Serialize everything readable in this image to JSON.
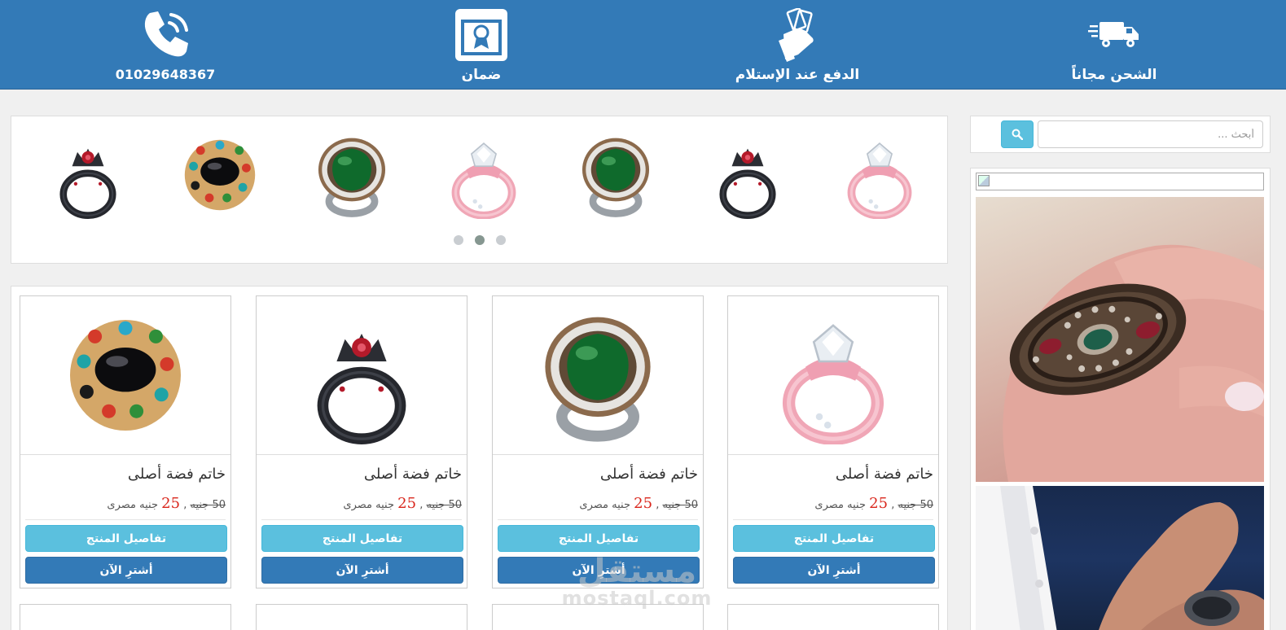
{
  "topbar": {
    "features": [
      {
        "icon": "truck-icon",
        "label": "الشحن مجاناً"
      },
      {
        "icon": "hand-money-icon",
        "label": "الدفع عند الإستلام"
      },
      {
        "icon": "certificate-icon",
        "label": "ضمان"
      },
      {
        "icon": "phone-icon",
        "label": "01029648367"
      }
    ]
  },
  "search": {
    "placeholder": "أبحث ...",
    "value": ""
  },
  "carousel": {
    "slides": [
      "pink-ring",
      "black-crown-ring",
      "emerald-ring",
      "pink-ring",
      "emerald-ring",
      "onyx-multigem-ring",
      "black-crown-ring",
      "pink-ring"
    ],
    "dots": 3,
    "active_dot": 1
  },
  "products": [
    {
      "image": "pink-ring",
      "title": "خاتم فضة أصلى",
      "old_price": "50 جنيه",
      "separator": ",",
      "new_price": "25",
      "currency": "جنيه مصرى",
      "details_label": "تفاصيل المنتج",
      "buy_label": "أشترِ الآن"
    },
    {
      "image": "emerald-ring",
      "title": "خاتم فضة أصلى",
      "old_price": "50 جنيه",
      "separator": ",",
      "new_price": "25",
      "currency": "جنيه مصرى",
      "details_label": "تفاصيل المنتج",
      "buy_label": "أشترِ الآن"
    },
    {
      "image": "black-crown-ring",
      "title": "خاتم فضة أصلى",
      "old_price": "50 جنيه",
      "separator": ",",
      "new_price": "25",
      "currency": "جنيه مصرى",
      "details_label": "تفاصيل المنتج",
      "buy_label": "أشترِ الآن"
    },
    {
      "image": "onyx-multigem-ring",
      "title": "خاتم فضة أصلى",
      "old_price": "50 جنيه",
      "separator": ",",
      "new_price": "25",
      "currency": "جنيه مصرى",
      "details_label": "تفاصيل المنتج",
      "buy_label": "أشترِ الآن"
    }
  ],
  "watermark": {
    "arabic": "مستقل",
    "latin": "mostaql.com"
  },
  "colors": {
    "primary": "#337ab7",
    "info": "#5bc0de",
    "price_red": "#d9261c",
    "page_bg": "#f0f0f0"
  }
}
